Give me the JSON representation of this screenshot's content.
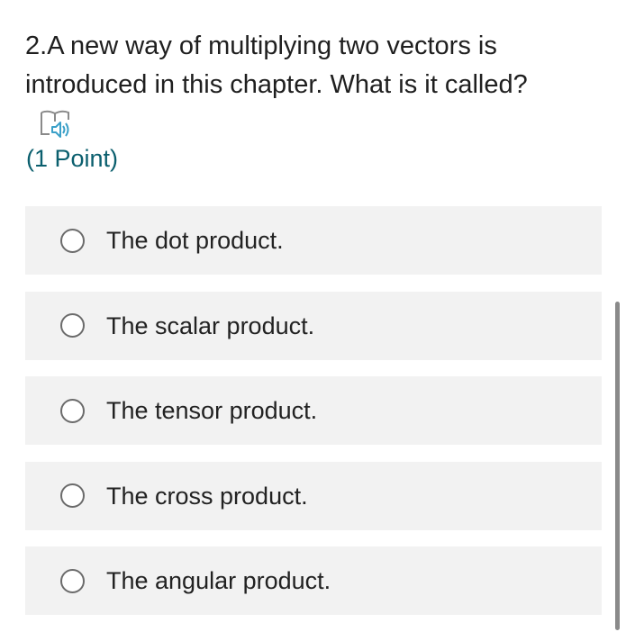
{
  "question": {
    "number": "2.",
    "text": "A new way of multiplying two vectors is introduced in this chapter. What is it called?",
    "points": "(1 Point)",
    "read_aloud_icon": "immersive-reader-icon"
  },
  "options": [
    {
      "label": "The dot product.",
      "selected": false
    },
    {
      "label": "The scalar product.",
      "selected": false
    },
    {
      "label": "The tensor product.",
      "selected": false
    },
    {
      "label": "The cross product.",
      "selected": false
    },
    {
      "label": "The angular product.",
      "selected": false
    }
  ],
  "colors": {
    "points_text": "#0b5f6e",
    "option_background": "#f2f2f2",
    "radio_border": "#6b6b6b",
    "icon_accent": "#3aa0c8"
  }
}
